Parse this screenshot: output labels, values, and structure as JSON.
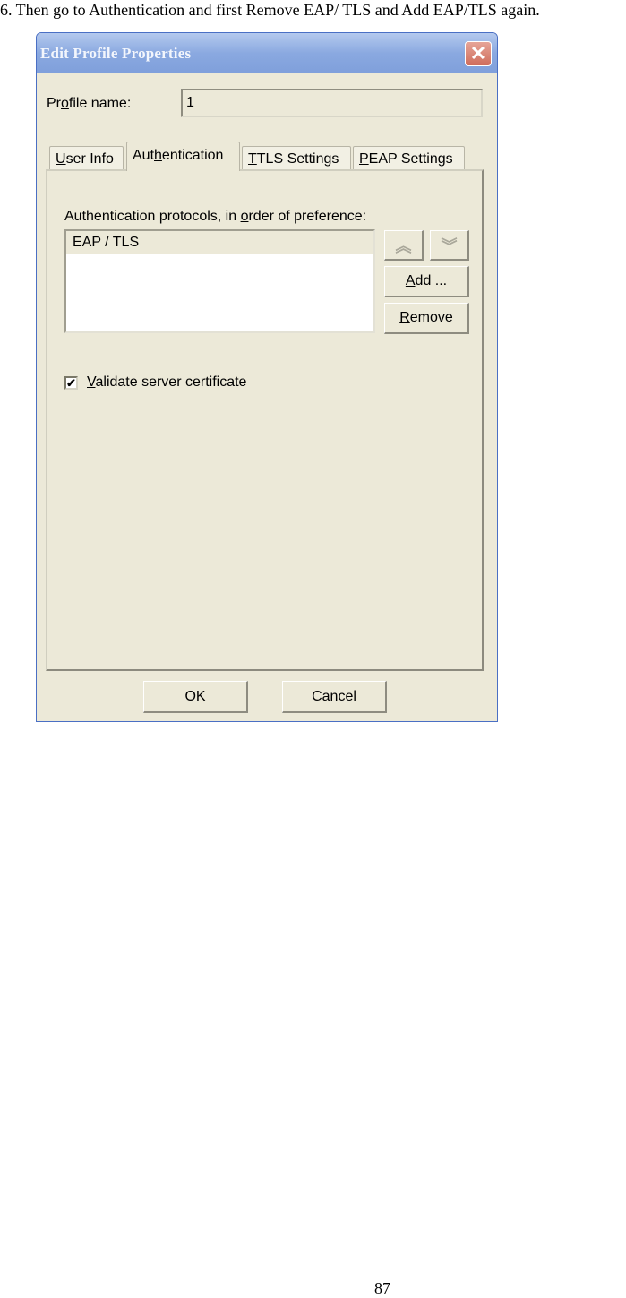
{
  "document": {
    "instruction": "6. Then go to Authentication and first Remove EAP/ TLS and Add EAP/TLS again.",
    "page_number": "87"
  },
  "dialog": {
    "title": "Edit Profile Properties",
    "close_icon": "close-icon",
    "profile_name_label_pre": "Pr",
    "profile_name_label_accel": "o",
    "profile_name_label_post": "file name:",
    "profile_name_value": "1",
    "tabs": [
      {
        "pre": "",
        "accel": "U",
        "post": "ser Info",
        "active": false
      },
      {
        "pre": "Aut",
        "accel": "h",
        "post": "entication",
        "active": true
      },
      {
        "pre": "",
        "accel": "T",
        "post": "TLS Settings",
        "active": false
      },
      {
        "pre": "",
        "accel": "P",
        "post": "EAP Settings",
        "active": false
      }
    ],
    "authentication": {
      "protocols_label_pre": "Authentication protocols, in ",
      "protocols_label_accel": "o",
      "protocols_label_post": "rder of preference:",
      "protocols": [
        "EAP / TLS"
      ],
      "move_up_icon": "double-chevron-up-icon",
      "move_down_icon": "double-chevron-down-icon",
      "move_up_glyph": "︽",
      "move_down_glyph": "︾",
      "add_accel": "A",
      "add_post": "dd ...",
      "remove_accel": "R",
      "remove_post": "emove",
      "validate_checked": true,
      "validate_check_glyph": "✔",
      "validate_accel": "V",
      "validate_post": "alidate server certificate"
    },
    "ok_label": "OK",
    "cancel_label": "Cancel",
    "close_glyph": "✕"
  }
}
